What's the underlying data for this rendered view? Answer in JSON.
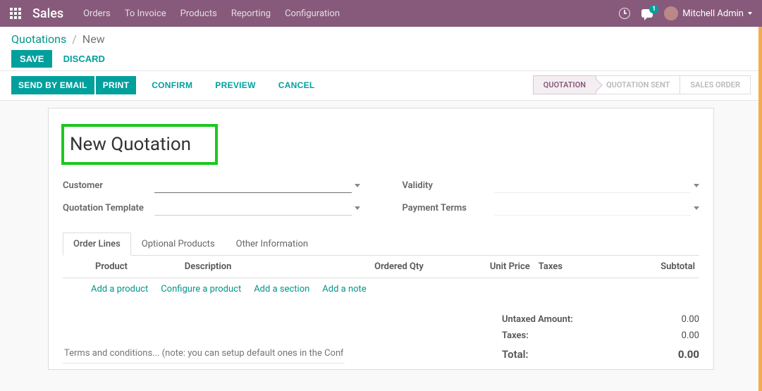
{
  "topbar": {
    "app_name": "Sales",
    "nav": [
      "Orders",
      "To Invoice",
      "Products",
      "Reporting",
      "Configuration"
    ],
    "chat_badge": "1",
    "user_name": "Mitchell Admin"
  },
  "breadcrumb": {
    "parent": "Quotations",
    "current": "New"
  },
  "buttons": {
    "save": "SAVE",
    "discard": "DISCARD",
    "send_email": "SEND BY EMAIL",
    "print": "PRINT",
    "confirm": "CONFIRM",
    "preview": "PREVIEW",
    "cancel": "CANCEL"
  },
  "status": {
    "steps": [
      "QUOTATION",
      "QUOTATION SENT",
      "SALES ORDER"
    ],
    "active_index": 0
  },
  "form": {
    "title": "New Quotation",
    "labels": {
      "customer": "Customer",
      "quotation_template": "Quotation Template",
      "validity": "Validity",
      "payment_terms": "Payment Terms"
    },
    "values": {
      "customer": "",
      "quotation_template": "",
      "validity": "",
      "payment_terms": ""
    }
  },
  "tabs": [
    "Order Lines",
    "Optional Products",
    "Other Information"
  ],
  "active_tab_index": 0,
  "table": {
    "columns": [
      "Product",
      "Description",
      "Ordered Qty",
      "Unit Price",
      "Taxes",
      "Subtotal"
    ],
    "rows": [],
    "add_links": [
      "Add a product",
      "Configure a product",
      "Add a section",
      "Add a note"
    ]
  },
  "terms_placeholder": "Terms and conditions... (note: you can setup default ones in the Configuration menu)",
  "totals": {
    "untaxed_label": "Untaxed Amount:",
    "untaxed_value": "0.00",
    "taxes_label": "Taxes:",
    "taxes_value": "0.00",
    "total_label": "Total:",
    "total_value": "0.00"
  }
}
